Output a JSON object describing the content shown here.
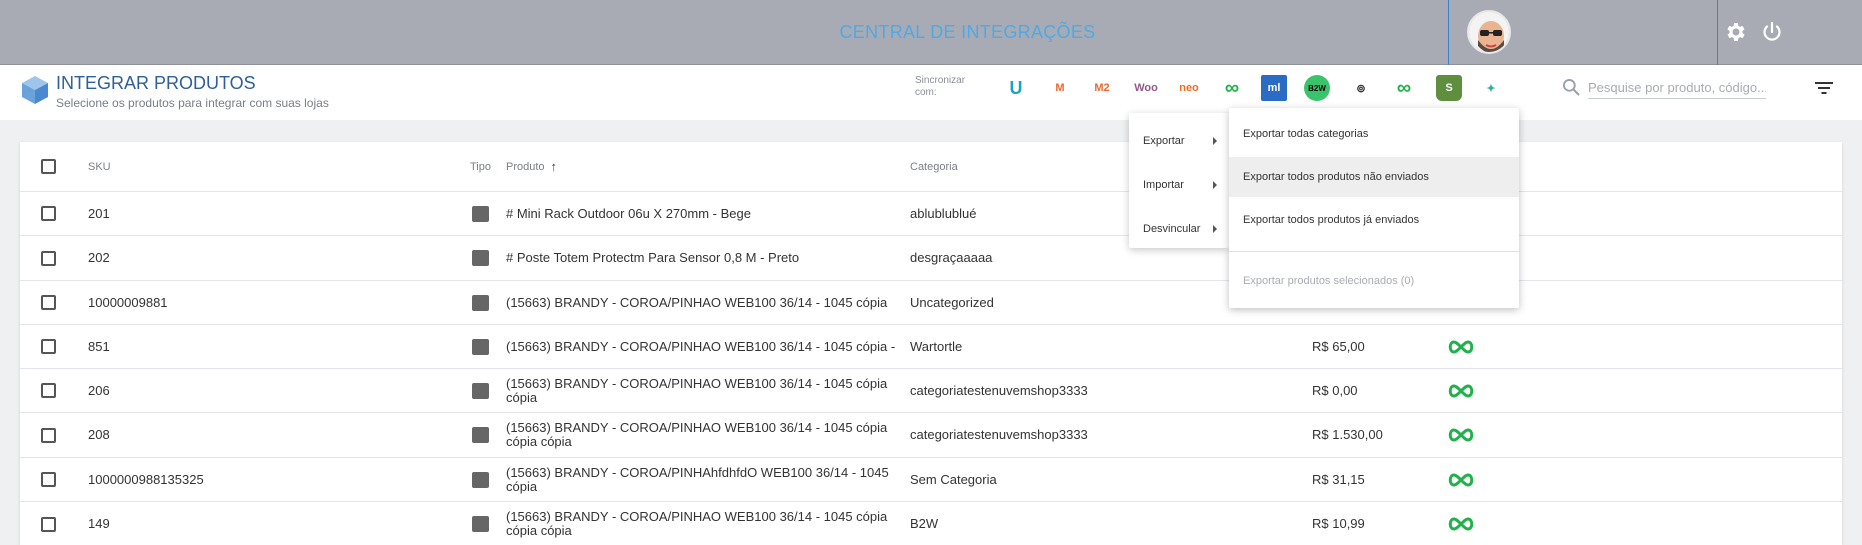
{
  "topbar": {
    "title": "CENTRAL DE INTEGRAÇÕES"
  },
  "header": {
    "title": "INTEGRAR PRODUTOS",
    "subtitle": "Selecione os produtos para integrar com suas lojas",
    "sync_label": "Sincronizar com:",
    "integrations": [
      {
        "icon": "u-logo-icon",
        "text": "U",
        "color": "#1aa3c7"
      },
      {
        "icon": "magento-icon",
        "text": "M",
        "color": "#ee672f"
      },
      {
        "icon": "magento2-icon",
        "text": "M2",
        "color": "#ee672f"
      },
      {
        "icon": "woo-icon",
        "text": "Woo",
        "color": "#96588a"
      },
      {
        "icon": "neo-icon",
        "text": "neo",
        "color": "#f26b21"
      },
      {
        "icon": "infinity-icon",
        "text": "∞",
        "color": "#21b14a"
      },
      {
        "icon": "ml-icon",
        "text": "ml",
        "color": "#2a6cc4"
      },
      {
        "icon": "b2w-icon",
        "text": "B2W",
        "color": "#000000"
      },
      {
        "icon": "link-icon",
        "text": "⊚",
        "color": "#333333"
      },
      {
        "icon": "infinity-br-icon",
        "text": "∞",
        "color": "#21b14a"
      },
      {
        "icon": "shopify-icon",
        "text": "S",
        "color": "#5e8e3e"
      },
      {
        "icon": "bird-icon",
        "text": "✦",
        "color": "#2db2a1"
      }
    ],
    "search_placeholder": "Pesquise por produto, código..."
  },
  "table": {
    "columns": {
      "sku": "SKU",
      "tipo": "Tipo",
      "produto": "Produto",
      "sort_arrow": "↑",
      "categoria": "Categoria"
    },
    "rows": [
      {
        "sku": "201",
        "produto": "# Mini Rack Outdoor 06u X 270mm - Bege",
        "categoria": "ablublublué",
        "preco": "",
        "status": false
      },
      {
        "sku": "202",
        "produto": "# Poste Totem Protectm Para Sensor 0,8 M - Preto",
        "categoria": "desgraçaaaaa",
        "preco": "",
        "status": false
      },
      {
        "sku": "10000009881",
        "produto": "(15663) BRANDY - COROA/PINHAO WEB100 36/14 - 1045 cópia",
        "categoria": "Uncategorized",
        "preco": "",
        "status": false
      },
      {
        "sku": "851",
        "produto": "(15663) BRANDY - COROA/PINHAO WEB100 36/14 - 1045 cópia -",
        "categoria": "Wartortle",
        "preco": "R$ 65,00",
        "status": true
      },
      {
        "sku": "206",
        "produto": "(15663) BRANDY - COROA/PINHAO WEB100 36/14 - 1045 cópia cópia",
        "categoria": "categoriatestenuvemshop3333",
        "preco": "R$ 0,00",
        "status": true
      },
      {
        "sku": "208",
        "produto": "(15663) BRANDY - COROA/PINHAO WEB100 36/14 - 1045 cópia cópia cópia",
        "categoria": "categoriatestenuvemshop3333",
        "preco": "R$ 1.530,00",
        "status": true
      },
      {
        "sku": "1000000988135325",
        "produto": "(15663) BRANDY - COROA/PINHAhfdhfdO WEB100 36/14 - 1045 cópia",
        "categoria": "Sem Categoria",
        "preco": "R$ 31,15",
        "status": true
      },
      {
        "sku": "149",
        "produto": "(15663) BRANDY - COROA/PINHAO WEB100 36/14 - 1045 cópia cópia cópia",
        "categoria": "B2W",
        "preco": "R$ 10,99",
        "status": true
      }
    ]
  },
  "menu": {
    "main": [
      {
        "label": "Exportar"
      },
      {
        "label": "Importar"
      },
      {
        "label": "Desvincular"
      }
    ],
    "submenu": [
      {
        "label": "Exportar todas categorias",
        "state": "normal"
      },
      {
        "label": "Exportar todos produtos não enviados",
        "state": "hover"
      },
      {
        "label": "Exportar todos produtos já enviados",
        "state": "normal"
      },
      {
        "label": "Exportar produtos selecionados (0)",
        "state": "disabled"
      }
    ]
  }
}
